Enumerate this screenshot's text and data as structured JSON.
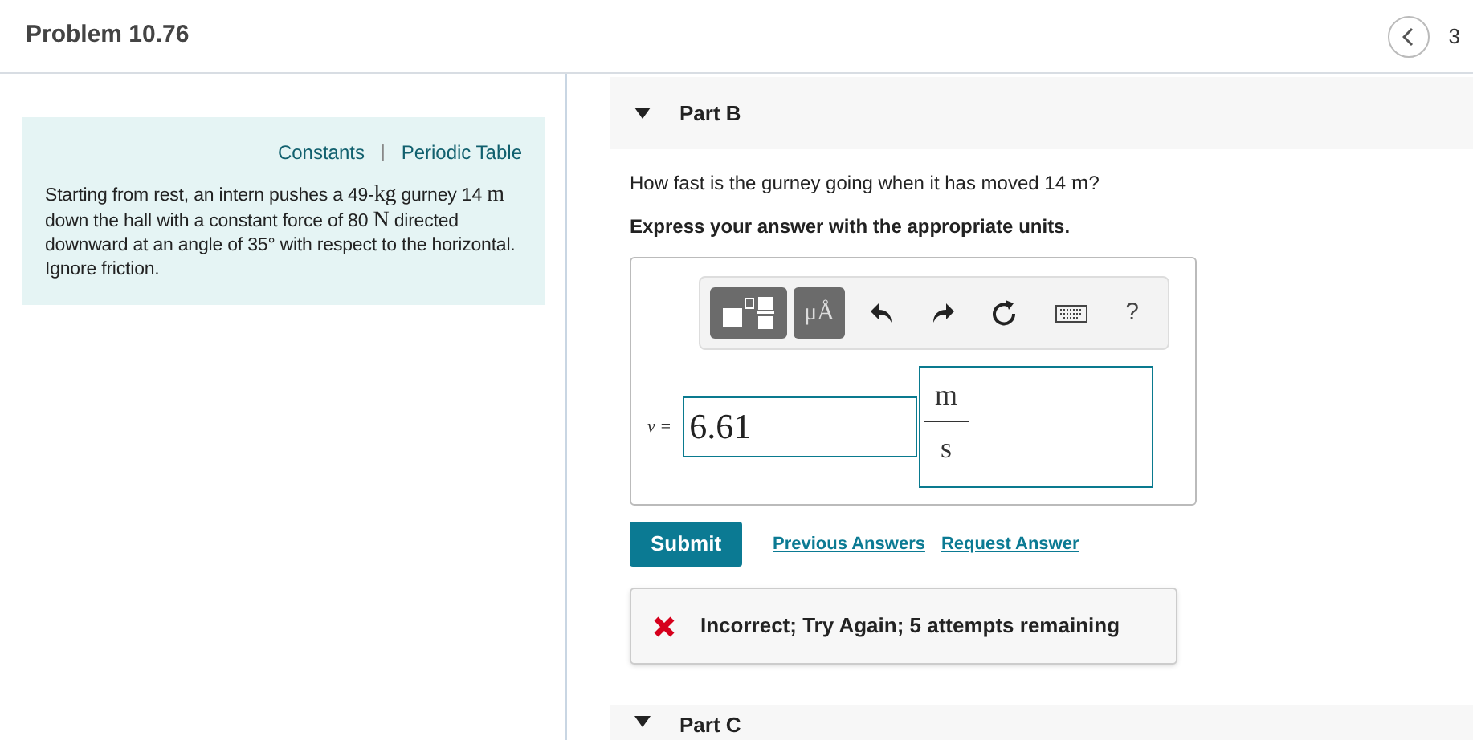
{
  "header": {
    "title": "Problem 10.76",
    "page": "3"
  },
  "info": {
    "links": [
      "Constants",
      "Periodic Table"
    ],
    "separator": "|",
    "problem": [
      {
        "kind": "text",
        "text": "Starting from rest, an intern pushes a 49-"
      },
      {
        "kind": "unit",
        "text": "kg"
      },
      {
        "kind": "text",
        "text": " gurney 14 "
      },
      {
        "kind": "unit",
        "text": "m"
      },
      {
        "kind": "text",
        "text": " down the hall with a constant force of 80 "
      },
      {
        "kind": "unit",
        "text": "N"
      },
      {
        "kind": "text",
        "text": " directed downward at an angle of 35° with respect to the horizontal. Ignore friction."
      }
    ]
  },
  "part": {
    "title": "Part B",
    "expanded": true,
    "question": [
      {
        "kind": "text",
        "text": "How fast is the gurney going when it has moved 14 "
      },
      {
        "kind": "unit",
        "text": "m"
      },
      {
        "kind": "text",
        "text": "?"
      }
    ],
    "instruction": "Express your answer with the appropriate units.",
    "toolbar": {
      "units_label": "μÅ",
      "help": "?"
    },
    "answer": {
      "variable": "v =",
      "value": "6.61",
      "unit_top": "m",
      "unit_bottom": "s"
    },
    "submit": "Submit",
    "links": [
      "Previous Answers",
      "Request Answer"
    ],
    "feedback": {
      "kind": "incorrect",
      "text": "Incorrect; Try Again; 5 attempts remaining"
    }
  },
  "next_part": {
    "title": "Part C",
    "expanded": true
  }
}
